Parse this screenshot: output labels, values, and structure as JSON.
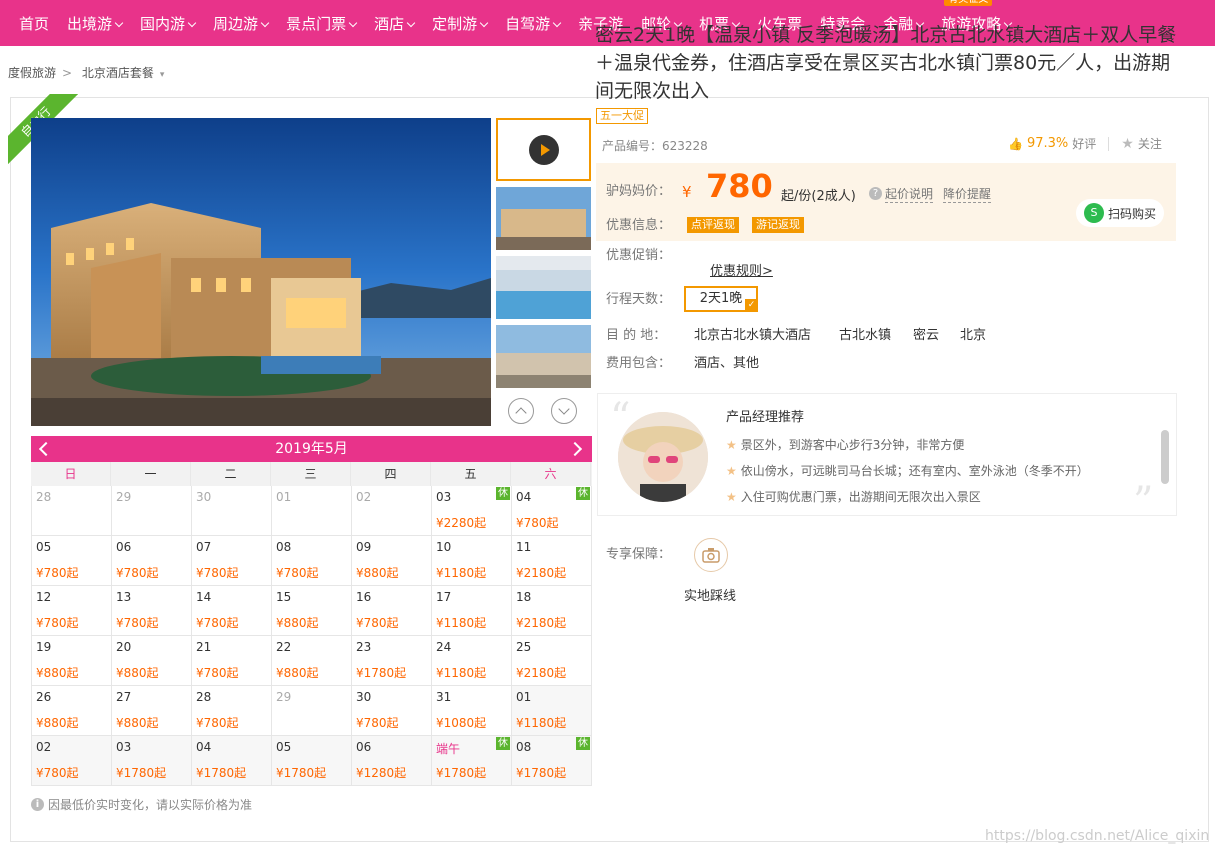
{
  "nav": {
    "items": [
      {
        "label": "首页",
        "caret": false
      },
      {
        "label": "出境游",
        "caret": true
      },
      {
        "label": "国内游",
        "caret": true
      },
      {
        "label": "周边游",
        "caret": true
      },
      {
        "label": "景点门票",
        "caret": true
      },
      {
        "label": "酒店",
        "caret": true
      },
      {
        "label": "定制游",
        "caret": true
      },
      {
        "label": "自驾游",
        "caret": true
      },
      {
        "label": "亲子游",
        "caret": false
      },
      {
        "label": "邮轮",
        "caret": true
      },
      {
        "label": "机票",
        "caret": true
      },
      {
        "label": "火车票",
        "caret": false
      },
      {
        "label": "特卖会",
        "caret": false
      },
      {
        "label": "金融",
        "caret": true
      },
      {
        "label": "旅游攻略",
        "caret": true
      }
    ],
    "badge": "有奖征文"
  },
  "breadcrumb": {
    "item1": "度假旅游",
    "sep": ">",
    "item2": "北京酒店套餐"
  },
  "ribbon": "自由行",
  "calendar": {
    "month": "2019年5月",
    "weekdays": [
      "日",
      "一",
      "二",
      "三",
      "四",
      "五",
      "六"
    ],
    "cells": [
      {
        "d": "28",
        "o": true
      },
      {
        "d": "29",
        "o": true
      },
      {
        "d": "30",
        "o": true
      },
      {
        "d": "01",
        "o": true
      },
      {
        "d": "02",
        "o": true
      },
      {
        "d": "03",
        "p": "¥2280起",
        "t": "休"
      },
      {
        "d": "04",
        "p": "¥780起",
        "t": "休"
      },
      {
        "d": "05",
        "p": "¥780起"
      },
      {
        "d": "06",
        "p": "¥780起"
      },
      {
        "d": "07",
        "p": "¥780起"
      },
      {
        "d": "08",
        "p": "¥780起"
      },
      {
        "d": "09",
        "p": "¥880起"
      },
      {
        "d": "10",
        "p": "¥1180起"
      },
      {
        "d": "11",
        "p": "¥2180起"
      },
      {
        "d": "12",
        "p": "¥780起"
      },
      {
        "d": "13",
        "p": "¥780起"
      },
      {
        "d": "14",
        "p": "¥780起"
      },
      {
        "d": "15",
        "p": "¥880起"
      },
      {
        "d": "16",
        "p": "¥780起"
      },
      {
        "d": "17",
        "p": "¥1180起"
      },
      {
        "d": "18",
        "p": "¥2180起"
      },
      {
        "d": "19",
        "p": "¥880起"
      },
      {
        "d": "20",
        "p": "¥880起"
      },
      {
        "d": "21",
        "p": "¥780起"
      },
      {
        "d": "22",
        "p": "¥880起"
      },
      {
        "d": "23",
        "p": "¥1780起"
      },
      {
        "d": "24",
        "p": "¥1180起"
      },
      {
        "d": "25",
        "p": "¥2180起"
      },
      {
        "d": "26",
        "p": "¥880起"
      },
      {
        "d": "27",
        "p": "¥880起"
      },
      {
        "d": "28",
        "p": "¥780起"
      },
      {
        "d": "29",
        "o": true
      },
      {
        "d": "30",
        "p": "¥780起"
      },
      {
        "d": "31",
        "p": "¥1080起"
      },
      {
        "d": "01",
        "p": "¥1180起",
        "g": true
      },
      {
        "d": "02",
        "p": "¥780起",
        "g": true
      },
      {
        "d": "03",
        "p": "¥1780起",
        "g": true
      },
      {
        "d": "04",
        "p": "¥1780起",
        "g": true
      },
      {
        "d": "05",
        "p": "¥1780起",
        "g": true
      },
      {
        "d": "06",
        "p": "¥1280起",
        "g": true
      },
      {
        "d": "端午",
        "p": "¥1780起",
        "t": "休",
        "g": true,
        "h": true
      },
      {
        "d": "08",
        "p": "¥1780起",
        "t": "休",
        "g": true
      }
    ],
    "note": "因最低价实时变化，请以实际价格为准"
  },
  "product": {
    "title": "密云2天1晚【温泉小镇 反季泡暖汤】北京古北水镇大酒店＋双人早餐＋温泉代金券，住酒店享受在景区买古北水镇门票80元／人，出游期间无限次出入",
    "promo": "五一大促",
    "id_label": "产品编号：623228",
    "rating": "97.3%",
    "rating_label": "好评",
    "follow": "关注"
  },
  "price": {
    "label": "驴妈妈价：",
    "currency": "¥",
    "value": "780",
    "unit": "起/份(2成人)",
    "explain": "起价说明",
    "alert": "降价提醒",
    "offer_label": "优惠信息：",
    "offer_tags": [
      "点评返现",
      "游记返现"
    ],
    "scan": "扫码购买"
  },
  "details": {
    "promo_label": "优惠促销：",
    "rules": "优惠规则>",
    "days_label": "行程天数：",
    "days_value": "2天1晚",
    "dest_label": "目 的 地：",
    "dest": [
      "北京古北水镇大酒店",
      "古北水镇",
      "密云",
      "北京"
    ],
    "fee_label": "费用包含：",
    "fee": "酒店、其他"
  },
  "manager": {
    "title": "产品经理推荐",
    "items": [
      "景区外，到游客中心步行3分钟，非常方便",
      "依山傍水，可远眺司马台长城；还有室内、室外泳池（冬季不开）",
      "入住可购优惠门票，出游期间无限次出入景区"
    ]
  },
  "guarantee": {
    "label": "专享保障：",
    "item": "实地踩线"
  },
  "watermark": "https://blog.csdn.net/Alice_qixin"
}
